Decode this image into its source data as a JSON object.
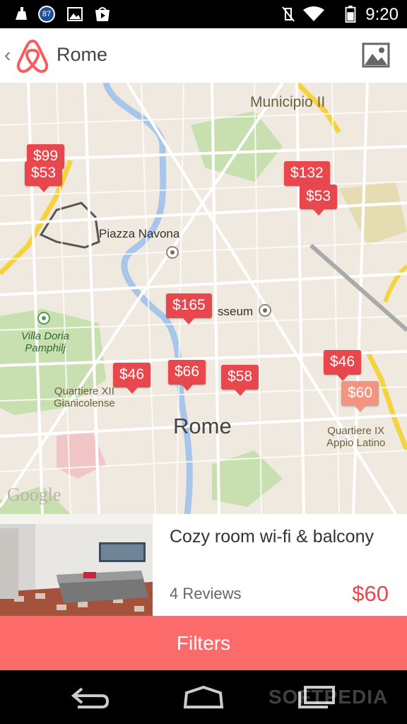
{
  "status_bar": {
    "notification_badge": "87",
    "time": "9:20",
    "icons": [
      "cleaner-icon",
      "badge-87-icon",
      "image-icon",
      "play-store-icon",
      "mute-icon",
      "wifi-icon",
      "battery-icon"
    ]
  },
  "app_bar": {
    "back": "‹",
    "title": "Rome",
    "brand_color": "#fc5a5f"
  },
  "map": {
    "labels": {
      "municipio": "Municipio II",
      "piazza": "Piazza Navona",
      "colosseum": "sseum",
      "villa": "Villa Doria\nPamphilj",
      "quartiere_xii": "Quartiere XII\nGianicolense",
      "rome": "Rome",
      "quartiere_ix": "Quartiere IX\nAppio Latino",
      "google": "Google"
    },
    "price_pins": [
      "$99",
      "$53",
      "$132",
      "$53",
      "$165",
      "$46",
      "$66",
      "$58",
      "$46",
      "$60"
    ],
    "selected_pin": "$60"
  },
  "listing": {
    "title": "Cozy room wi-fi & balcony",
    "reviews": "4 Reviews",
    "price": "$60"
  },
  "filters_label": "Filters",
  "nav": {
    "watermark": "SOFTPEDIA"
  },
  "colors": {
    "pin": "#e8474d",
    "pin_selected": "#f39480",
    "filters_bar": "#fc6a6a",
    "price_text": "#e8474d"
  }
}
